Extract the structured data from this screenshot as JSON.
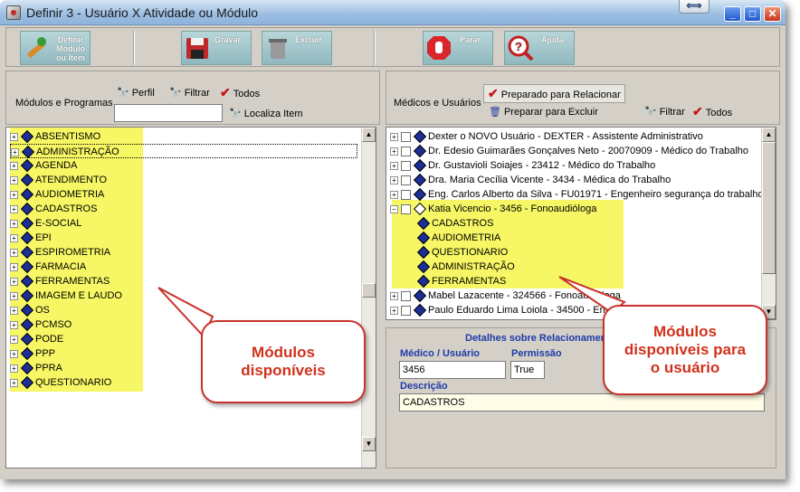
{
  "window": {
    "title": "Definir 3 - Usuário X Atividade ou Módulo"
  },
  "toolbar": {
    "definir": "Definir Módulo ou Item",
    "gravar": "Gravar",
    "excluir": "Excluir",
    "parar": "Parar",
    "ajuda": "Ajuda"
  },
  "left": {
    "header_label": "Módulos e Programas",
    "perfil": "Perfil",
    "filtrar": "Filtrar",
    "todos": "Todos",
    "localiza": "Localiza Item",
    "search_value": "",
    "modules": [
      "ABSENTISMO",
      "ADMINISTRAÇÃO",
      "AGENDA",
      "ATENDIMENTO",
      "AUDIOMETRIA",
      "CADASTROS",
      "E-SOCIAL",
      "EPI",
      "ESPIROMETRIA",
      "FARMACIA",
      "FERRAMENTAS",
      "IMAGEM E LAUDO",
      "OS",
      "PCMSO",
      "PODE",
      "PPP",
      "PPRA",
      "QUESTIONARIO"
    ]
  },
  "right": {
    "header_label": "Médicos e Usuários",
    "preparado_relacionar": "Preparado para Relacionar",
    "preparar_excluir": "Preparar para Excluir",
    "filtrar": "Filtrar",
    "todos": "Todos",
    "users_top": [
      "Dexter o NOVO Usuário - DEXTER - Assistente Administrativo",
      "Dr. Edesio Guimarães Gonçalves Neto - 20070909 - Médico do Trabalho",
      "Dr. Gustavioli Soiajes - 23412 - Médico do Trabalho",
      "Dra. Maria Cecília Vicente - 3434 - Médica do Trabalho",
      "Eng. Carlos Alberto da Silva - FU01971 - Engenheiro segurança do trabalho"
    ],
    "expanded_user": "Katia Vicencio - 3456 - Fonoaudióloga",
    "expanded_modules": [
      "CADASTROS",
      "AUDIOMETRIA",
      "QUESTIONARIO",
      "ADMINISTRAÇÃO",
      "FERRAMENTAS"
    ],
    "users_bottom": [
      "Mabel Lazacente - 324566 - Fonoaudióloga",
      "Paulo Eduardo Lima Loiola - 34500 - Enfermeiro"
    ]
  },
  "details": {
    "title": "Detalhes sobre Relacionamento",
    "medico_label": "Médico / Usuário",
    "medico_value": "3456",
    "permissao_label": "Permissão",
    "permissao_value": "True",
    "descricao_label": "Descrição",
    "descricao_value": "CADASTROS"
  },
  "callouts": {
    "left": "Módulos disponíveis",
    "right": "Módulos disponíveis para o usuário"
  },
  "colors": {
    "highlight": "#f7f765",
    "callout": "#d0321c",
    "title_text": "#1e3aa8"
  }
}
